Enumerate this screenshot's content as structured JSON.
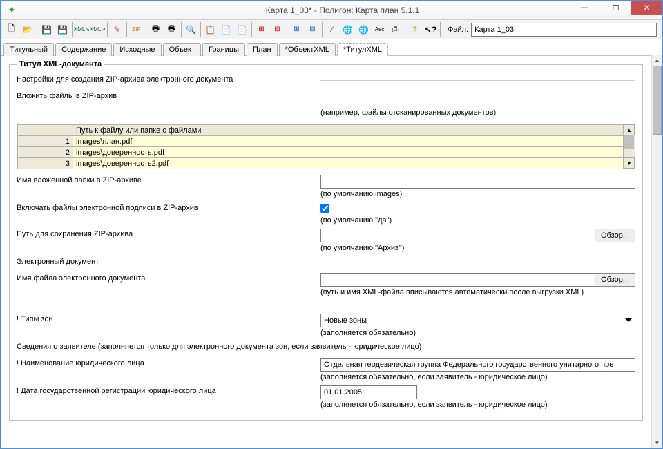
{
  "window": {
    "title": "Карта 1_03* - Полигон: Карта план 5.1.1"
  },
  "toolbar": {
    "file_label": "Файл:",
    "file_value": "Карта 1_03"
  },
  "tabs": [
    {
      "label": "Титульный",
      "active": false
    },
    {
      "label": "Содержание",
      "active": false
    },
    {
      "label": "Исходные",
      "active": false
    },
    {
      "label": "Объект",
      "active": false
    },
    {
      "label": "Границы",
      "active": false
    },
    {
      "label": "План",
      "active": false
    },
    {
      "label": "*ОбъектXML",
      "active": false
    },
    {
      "label": "*ТитулXML",
      "active": true
    }
  ],
  "section": {
    "legend": "Титул XML-документа",
    "zip_settings_label": "Настройки для создания ZIP-архива электронного документа",
    "attach_files_label": "Вложить файлы в ZIP-архив",
    "attach_files_hint": "(например, файлы отсканированных документов)",
    "table": {
      "path_header": "Путь к файлу или папке с файлами",
      "rows": [
        {
          "num": "1",
          "path": "images\\план.pdf"
        },
        {
          "num": "2",
          "path": "images\\доверенность.pdf"
        },
        {
          "num": "3",
          "path": "images\\доверенность2.pdf"
        }
      ]
    },
    "folder_name_label": "Имя вложенной папки в ZIP-архиве",
    "folder_name_value": "",
    "folder_name_hint": "(по умолчанию images)",
    "include_sig_label": "Включать файлы электронной подписи в ZIP-архив",
    "include_sig_checked": true,
    "include_sig_hint": "(по умолчанию \"да\")",
    "zip_path_label": "Путь для сохранения ZIP-архива",
    "zip_path_value": "",
    "zip_path_hint": "(по умолчанию \"Архив\")",
    "browse_label": "Обзор...",
    "edoc_label": "Электронный документ",
    "edoc_name_label": "Имя файла электронного документа",
    "edoc_name_value": "",
    "edoc_name_hint": "(путь и имя XML-файла вписываются автоматически после выгрузки XML)",
    "zone_types_label": "! Типы зон",
    "zone_types_value": "Новые зоны",
    "zone_types_hint": "(заполняется обязательно)",
    "applicant_info_label": "Сведения о заявителе (заполняется только для электронного документа зон, если заявитель - юридическое лицо)",
    "legal_name_label": "! Наименование юридического лица",
    "legal_name_value": "Отдельная геодезическая группа Федерального государственного унитарного пре",
    "legal_name_hint": "(заполняется обязательно, если заявитель - юридическое лицо)",
    "reg_date_label": "! Дата государственной регистрации юридического лица",
    "reg_date_value": "01.01.2005",
    "reg_date_hint": "(заполняется обязательно, если заявитель - юридическое лицо)"
  }
}
